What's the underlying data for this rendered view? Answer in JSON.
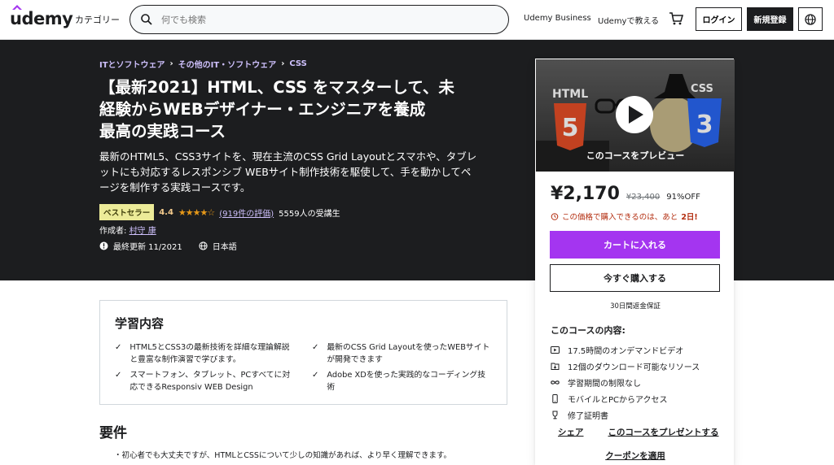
{
  "header": {
    "logo": "udemy",
    "categories": "カテゴリー",
    "search_placeholder": "何でも検索",
    "business": "Udemy Business",
    "teach": "Udemyで教える",
    "login": "ログイン",
    "signup": "新規登録"
  },
  "breadcrumb": [
    "ITとソフトウェア",
    "その他のIT・ソフトウェア",
    "CSS"
  ],
  "course": {
    "title_lines": [
      "【最新2021】HTML、CSS をマスターして、未",
      "経験からWEBデザイナー・エンジニアを養成",
      "最高の実践コース"
    ],
    "subtitle_lines": [
      "最新のHTML5、CSS3サイトを、現在主流のCSS Grid Layoutとスマホや、タブレ",
      "ットにも対応するレスポンシブ WEBサイト制作技術を駆使して、手を動かしてペ",
      "ージを制作する実践コースです。"
    ],
    "badge": "ベストセラー",
    "rating": "4.4",
    "stars": "★★★★☆",
    "reviews": "(919件の評価)",
    "students": "5559人の受講生",
    "author_label": "作成者:",
    "author": "村守 康",
    "updated": "最終更新 11/2021",
    "language": "日本語"
  },
  "card": {
    "preview_label": "このコースをプレビュー",
    "preview_badges": [
      "HTML",
      "CSS"
    ],
    "price": "¥2,170",
    "price_original": "¥23,400",
    "discount": "91%OFF",
    "timer_text": "この価格で購入できるのは、あと",
    "timer_days": "2日!",
    "add_to_cart": "カートに入れる",
    "buy_now": "今すぐ購入する",
    "guarantee": "30日間返金保証",
    "includes_title": "このコースの内容:",
    "includes": [
      {
        "icon": "video-icon",
        "text": "17.5時間のオンデマンドビデオ"
      },
      {
        "icon": "file-icon",
        "text": "12個のダウンロード可能なリソース"
      },
      {
        "icon": "infinity-icon",
        "text": "学習期間の制限なし"
      },
      {
        "icon": "mobile-icon",
        "text": "モバイルとPCからアクセス"
      },
      {
        "icon": "trophy-icon",
        "text": "修了証明書"
      }
    ],
    "share": "シェア",
    "gift": "このコースをプレゼントする",
    "coupon": "クーポンを適用"
  },
  "learn": {
    "title": "学習内容",
    "items": [
      [
        "HTML5とCSS3の最新技術を詳細な理論解説",
        "と豊富な制作演習で学びます。"
      ],
      [
        "最新のCSS Grid Layoutを使ったWEBサイト",
        "が開発できます"
      ],
      [
        "スマートフォン、タブレット、PCすべてに対",
        "応できるResponsiv WEB Design"
      ],
      [
        "Adobe XDを使った実践的なコーディング技",
        "術"
      ]
    ]
  },
  "requirements": {
    "title": "要件",
    "first_line": "・初心者でも大丈夫ですが、HTMLとCSSについて少しの知識があれば、より早く理解できます。"
  },
  "colors": {
    "accent": "#a435f0",
    "dark": "#1c1d1f",
    "link_purple": "#cec0fc",
    "badge": "#eceb98",
    "star": "#e59819",
    "alert": "#b32d0f"
  }
}
